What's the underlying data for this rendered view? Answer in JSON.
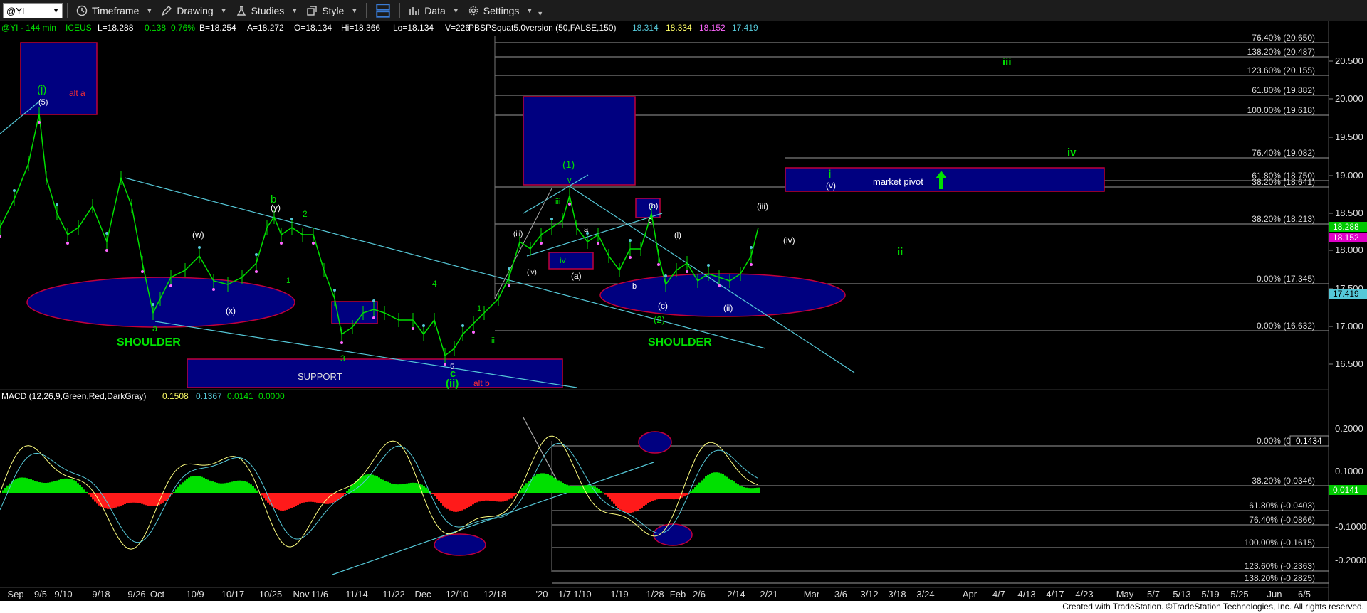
{
  "toolbar": {
    "symbol": "@YI",
    "timeframe": "Timeframe",
    "drawing": "Drawing",
    "studies": "Studies",
    "style": "Style",
    "data": "Data",
    "settings": "Settings"
  },
  "price_header": {
    "symbol": "@YI - 144 min",
    "exchange": "ICEUS",
    "last": "L=18.288",
    "change": "0.138",
    "pct": "0.76%",
    "bid": "B=18.254",
    "ask": "A=18.272",
    "open": "O=18.134",
    "high": "Hi=18.366",
    "low": "Lo=18.134",
    "vol": "V=226",
    "study": "PBSPSquat5.0version (50,FALSE,150)",
    "v1": "18.314",
    "v2": "18.334",
    "v3": "18.152",
    "v4": "17.419"
  },
  "macd_header": {
    "label": "MACD (12,26,9,Green,Red,DarkGray)",
    "v1": "0.1508",
    "v2": "0.1367",
    "v3": "0.0141",
    "v4": "0.0000"
  },
  "price_axis": [
    "20.500",
    "20.000",
    "19.500",
    "19.000",
    "18.500",
    "18.000",
    "17.500",
    "17.000",
    "16.500"
  ],
  "macd_axis": [
    "0.2000",
    "0.1000",
    "-0.1000",
    "-0.2000"
  ],
  "price_tags": {
    "last": "18.288",
    "b": "18.152",
    "c": "17.419"
  },
  "macd_tags": {
    "a": "0.1434",
    "b": "0.0141"
  },
  "fib_price": [
    {
      "label": "76.40% (20.650)"
    },
    {
      "label": "138.20% (20.487)"
    },
    {
      "label": "123.60% (20.155)"
    },
    {
      "label": "61.80% (19.882)"
    },
    {
      "label": "100.00% (19.618)"
    },
    {
      "label": "76.40% (19.082)"
    },
    {
      "label": "61.80% (18.750)"
    },
    {
      "label": "38.20% (18.641)"
    },
    {
      "label": "38.20% (18.213)"
    },
    {
      "label": "0.00% (17.345)"
    },
    {
      "label": "0.00% (16.632)"
    }
  ],
  "fib_macd": [
    {
      "label": "0.00% (0.1557)"
    },
    {
      "label": "38.20% (0.0346)"
    },
    {
      "label": "61.80% (-0.0403)"
    },
    {
      "label": "76.40% (-0.0866)"
    },
    {
      "label": "100.00% (-0.1615)"
    },
    {
      "label": "123.60% (-0.2363)"
    },
    {
      "label": "138.20% (-0.2825)"
    }
  ],
  "x_axis": [
    "Sep",
    "9/5",
    "9/10",
    "9/18",
    "9/26",
    "Oct",
    "10/9",
    "10/17",
    "10/25",
    "Nov",
    "11/6",
    "11/14",
    "11/22",
    "Dec",
    "12/10",
    "12/18",
    "'20",
    "1/7",
    "1/10",
    "1/19",
    "1/28",
    "Feb",
    "2/6",
    "2/14",
    "2/21",
    "Mar",
    "3/6",
    "3/12",
    "3/18",
    "3/24",
    "Apr",
    "4/7",
    "4/13",
    "4/17",
    "4/23",
    "May",
    "5/7",
    "5/13",
    "5/19",
    "5/25",
    "Jun",
    "6/5"
  ],
  "annotations": {
    "alt_a": "alt a",
    "alt_b": "alt b",
    "support": "SUPPORT",
    "shoulder_left": "SHOULDER",
    "shoulder_right": "SHOULDER",
    "market_pivot": "market pivot",
    "j": "(j)",
    "five_top": "(5)",
    "w": "(w)",
    "x": "(x)",
    "y": "(y)",
    "b_green": "b",
    "a_green": "a",
    "c_green": "c",
    "ii_green": "(ii)",
    "n1": "1",
    "n2": "2",
    "n3": "3",
    "n4": "4",
    "n5": "5",
    "w1": "(1)",
    "w2": "(2)",
    "v_green": "v",
    "iii_small": "iii",
    "iv_box": "iv",
    "iv_paren": "(iv)",
    "iii_paren_small": "(iii)",
    "a_paren": "(a)",
    "b_paren": "(b)",
    "c_paren": "(c)",
    "a_white": "a",
    "b_white": "b",
    "c_white": "c",
    "i_paren": "(i)",
    "ii_paren": "(ii)",
    "iii_paren": "(iii)",
    "iv_paren_right": "(iv)",
    "i_green": "i",
    "v_paren": "(v)",
    "ii_right": "ii",
    "iii_right": "iii",
    "iv_right": "iv",
    "small_1": "1",
    "small_ii": "ii"
  },
  "footer": "Created with TradeStation. ©TradeStation Technologies, Inc. All rights reserved.",
  "colors": {
    "green": "#00e000",
    "blue_box": "#000080",
    "red_border": "#c0003c",
    "cyan": "#55c8d8",
    "fib_line": "#9a9a9a",
    "price_tag": "#00c800",
    "magenta": "#e000c8"
  }
}
